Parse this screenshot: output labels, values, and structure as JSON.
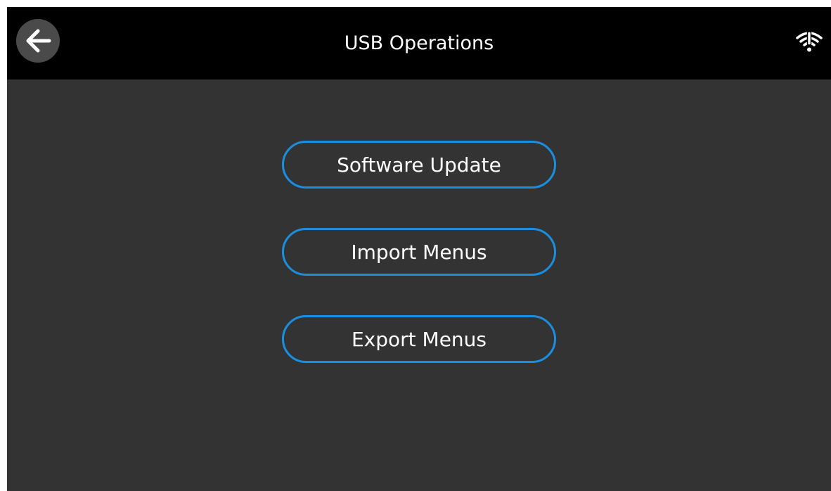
{
  "header": {
    "title": "USB Operations",
    "back_icon": "arrow-left-icon",
    "status_icon": "wifi-alert-icon"
  },
  "menu": {
    "items": [
      {
        "label": "Software Update"
      },
      {
        "label": "Import Menus"
      },
      {
        "label": "Export Menus"
      }
    ]
  },
  "colors": {
    "background": "#333333",
    "header": "#000000",
    "accent": "#1a8fe0",
    "text": "#ffffff"
  }
}
